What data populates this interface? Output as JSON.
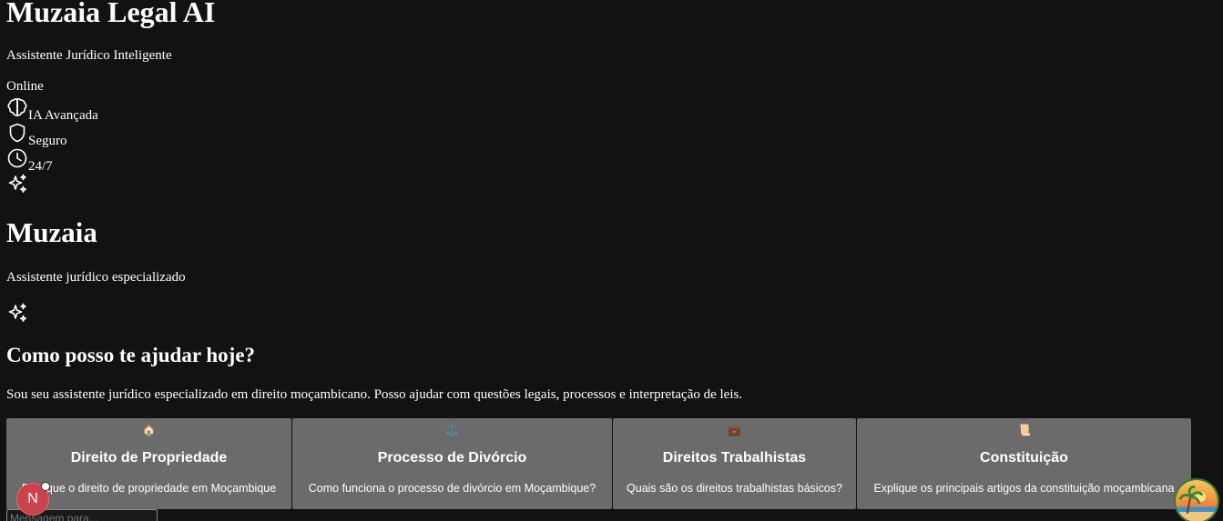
{
  "header": {
    "title": "Muzaia Legal AI",
    "subtitle": "Assistente Jurídico Inteligente",
    "status": "Online"
  },
  "features": [
    {
      "icon": "brain-icon",
      "label": "IA Avançada"
    },
    {
      "icon": "shield-icon",
      "label": "Seguro"
    },
    {
      "icon": "clock-icon",
      "label": "24/7"
    }
  ],
  "brand": {
    "name": "Muzaia",
    "tagline": "Assistente jurídico especializado"
  },
  "welcome": {
    "title": "Como posso te ajudar hoje?",
    "text": "Sou seu assistente jurídico especializado em direito moçambicano. Posso ajudar com questões legais, processos e interpretação de leis."
  },
  "suggestions": [
    {
      "icon": "🏠",
      "title": "Direito de Propriedade",
      "prompt": "Explique o direito de propriedade em Moçambique"
    },
    {
      "icon": "⚖️",
      "title": "Processo de Divórcio",
      "prompt": "Como funciona o processo de divórcio em Moçambique?"
    },
    {
      "icon": "💼",
      "title": "Direitos Trabalhistas",
      "prompt": "Quais são os direitos trabalhistas básicos?"
    },
    {
      "icon": "📜",
      "title": "Constituição",
      "prompt": "Explique os principais artigos da constituição moçambicana"
    }
  ],
  "input": {
    "placeholder": "Mensagem para..."
  },
  "user_avatar": {
    "initial": "N"
  },
  "colors": {
    "background": "#121212",
    "card": "#6b6b6b",
    "avatar": "#c9444a"
  }
}
